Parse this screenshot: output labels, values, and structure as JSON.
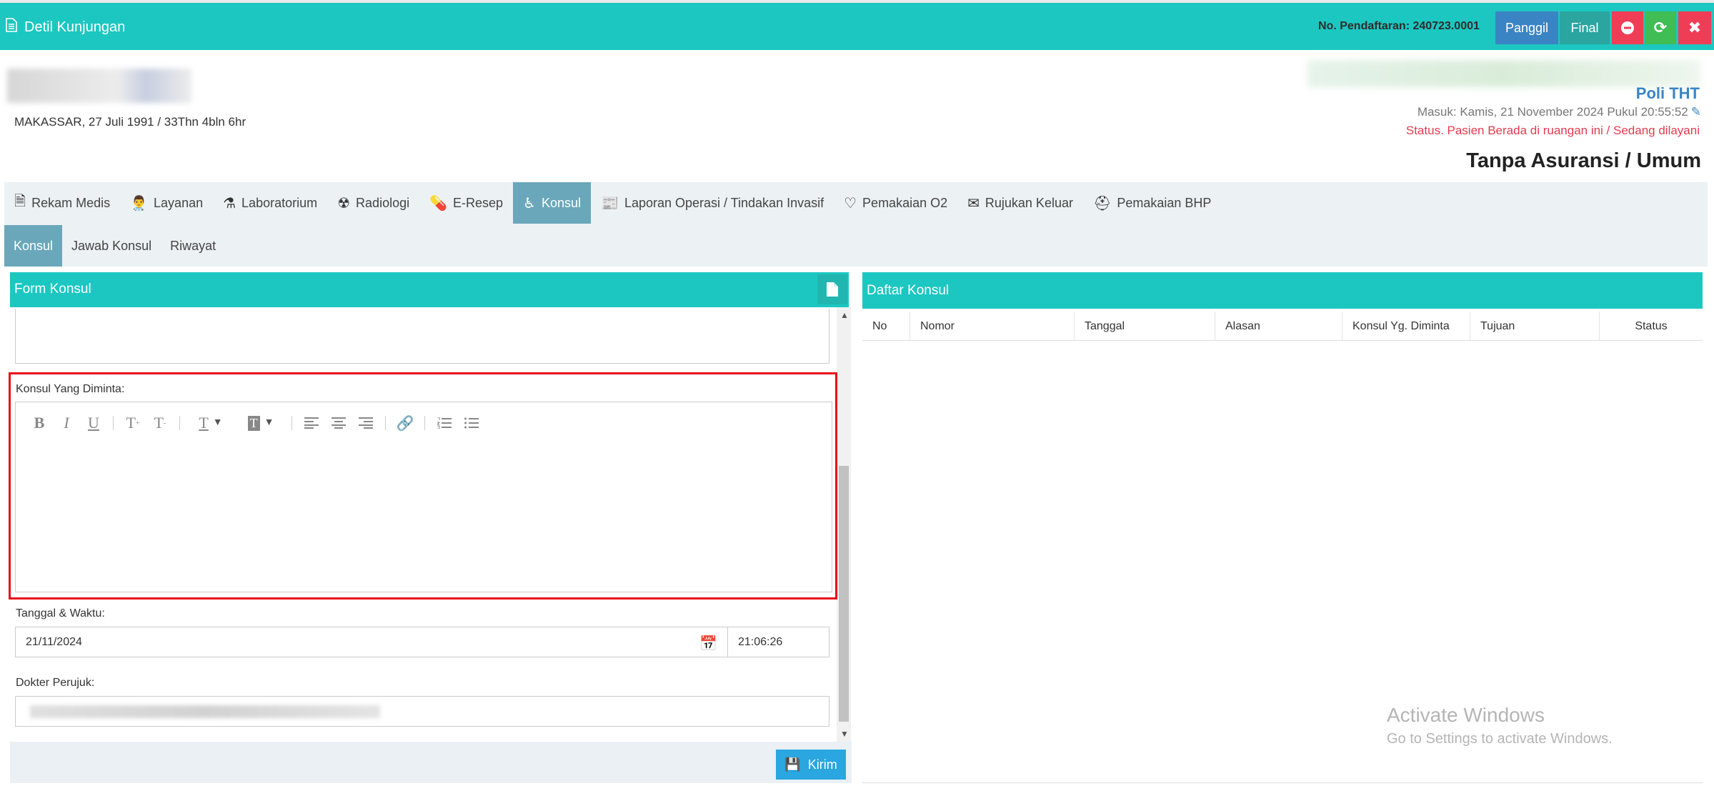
{
  "header": {
    "title": "Detil Kunjungan",
    "registration": "No. Pendaftaran: 240723.0001",
    "buttons": {
      "panggil": "Panggil",
      "final": "Final"
    }
  },
  "patient": {
    "birth_info": "MAKASSAR, 27 Juli 1991 / 33Thn 4bln 6hr",
    "poli": "Poli THT",
    "masuk": "Masuk: Kamis, 21 November 2024 Pukul 20:55:52",
    "status": "Status. Pasien Berada di ruangan ini / Sedang dilayani",
    "insurance": "Tanpa Asuransi / Umum"
  },
  "main_tabs": [
    {
      "label": "Rekam Medis",
      "icon": "file-icon"
    },
    {
      "label": "Layanan",
      "icon": "user-md-icon"
    },
    {
      "label": "Laboratorium",
      "icon": "flask-icon"
    },
    {
      "label": "Radiologi",
      "icon": "radiology-icon"
    },
    {
      "label": "E-Resep",
      "icon": "pill-icon"
    },
    {
      "label": "Konsul",
      "icon": "wheelchair-icon",
      "active": true
    },
    {
      "label": "Laporan Operasi / Tindakan Invasif",
      "icon": "newspaper-icon"
    },
    {
      "label": "Pemakaian O2",
      "icon": "heart-icon"
    },
    {
      "label": "Rujukan Keluar",
      "icon": "envelope-icon"
    },
    {
      "label": "Pemakaian BHP",
      "icon": "medkit-icon"
    }
  ],
  "sub_tabs": [
    {
      "label": "Konsul",
      "active": true
    },
    {
      "label": "Jawab Konsul"
    },
    {
      "label": "Riwayat"
    }
  ],
  "form": {
    "title": "Form Konsul",
    "konsul_label": "Konsul Yang Diminta:",
    "datetime_label": "Tanggal & Waktu:",
    "date_value": "21/11/2024",
    "time_value": "21:06:26",
    "dokter_label": "Dokter Perujuk:",
    "submit": "Kirim"
  },
  "list": {
    "title": "Daftar Konsul",
    "columns": [
      "No",
      "Nomor",
      "Tanggal",
      "Alasan",
      "Konsul Yg. Diminta",
      "Tujuan",
      "Status"
    ]
  },
  "watermark": {
    "line1": "Activate Windows",
    "line2": "Go to Settings to activate Windows."
  },
  "colors": {
    "teal": "#1cc7c1",
    "active_tab": "#6aa7bb",
    "danger": "#ef3d56",
    "success": "#40bd54",
    "primary": "#3a84c4"
  }
}
